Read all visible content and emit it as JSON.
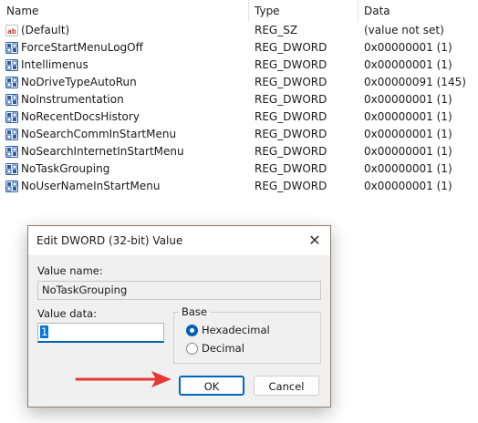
{
  "columns": {
    "name": "Name",
    "type": "Type",
    "data": "Data"
  },
  "entries": [
    {
      "name": "(Default)",
      "type": "REG_SZ",
      "data": "(value not set)",
      "icon": "string-value-icon"
    },
    {
      "name": "ForceStartMenuLogOff",
      "type": "REG_DWORD",
      "data": "0x00000001 (1)",
      "icon": "binary-value-icon"
    },
    {
      "name": "Intellimenus",
      "type": "REG_DWORD",
      "data": "0x00000001 (1)",
      "icon": "binary-value-icon"
    },
    {
      "name": "NoDriveTypeAutoRun",
      "type": "REG_DWORD",
      "data": "0x00000091 (145)",
      "icon": "binary-value-icon"
    },
    {
      "name": "NoInstrumentation",
      "type": "REG_DWORD",
      "data": "0x00000001 (1)",
      "icon": "binary-value-icon"
    },
    {
      "name": "NoRecentDocsHistory",
      "type": "REG_DWORD",
      "data": "0x00000001 (1)",
      "icon": "binary-value-icon"
    },
    {
      "name": "NoSearchCommInStartMenu",
      "type": "REG_DWORD",
      "data": "0x00000001 (1)",
      "icon": "binary-value-icon"
    },
    {
      "name": "NoSearchInternetInStartMenu",
      "type": "REG_DWORD",
      "data": "0x00000001 (1)",
      "icon": "binary-value-icon"
    },
    {
      "name": "NoTaskGrouping",
      "type": "REG_DWORD",
      "data": "0x00000001 (1)",
      "icon": "binary-value-icon"
    },
    {
      "name": "NoUserNameInStartMenu",
      "type": "REG_DWORD",
      "data": "0x00000001 (1)",
      "icon": "binary-value-icon"
    }
  ],
  "dialog": {
    "title": "Edit DWORD (32-bit) Value",
    "value_name_label": "Value name:",
    "value_name": "NoTaskGrouping",
    "value_data_label": "Value data:",
    "value_data": "1",
    "base_label": "Base",
    "base_options": [
      {
        "label": "Hexadecimal",
        "selected": true
      },
      {
        "label": "Decimal",
        "selected": false
      }
    ],
    "ok_label": "OK",
    "cancel_label": "Cancel"
  },
  "colors": {
    "accent": "#005fb8",
    "arrow": "#e53935",
    "dialog_border": "#8c7f6b"
  }
}
